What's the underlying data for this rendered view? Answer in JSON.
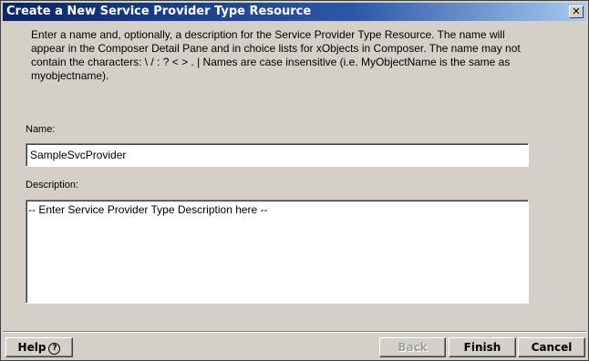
{
  "window": {
    "title": "Create a New Service Provider Type Resource",
    "close_glyph": "✕",
    "instructions": "Enter a name and, optionally, a description for the Service Provider Type Resource. The name will appear in the Composer Detail Pane and in choice lists for xObjects in Composer. The name may not contain the characters: \\ / : ? < > . |   Names are case insensitive (i.e. MyObjectName is the same as myobjectname)."
  },
  "form": {
    "name_label": "Name:",
    "name_value": "SampleSvcProvider",
    "description_label": "Description:",
    "description_value": "-- Enter Service Provider Type Description here --"
  },
  "buttons": {
    "help_label": "Help",
    "help_icon": "?",
    "back_label": "Back",
    "finish_label": "Finish",
    "cancel_label": "Cancel"
  }
}
